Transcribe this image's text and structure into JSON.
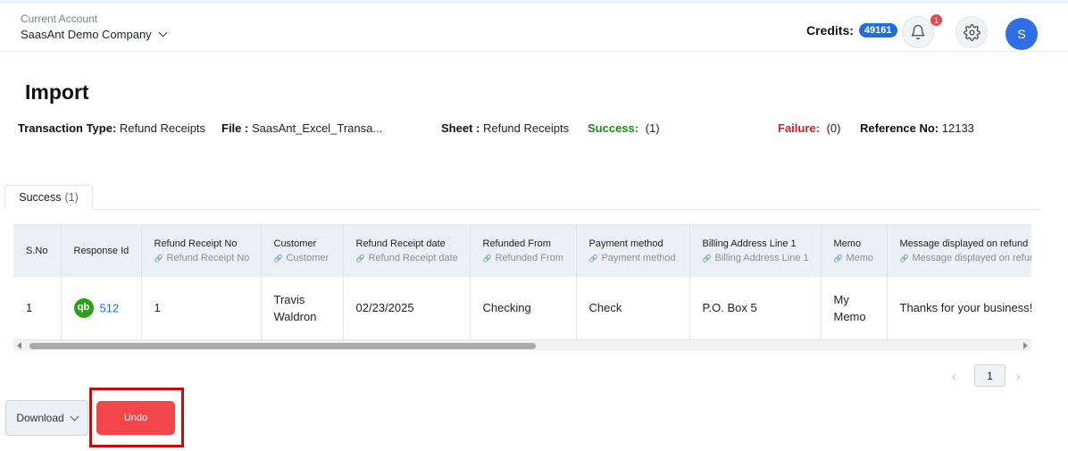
{
  "header": {
    "account_label": "Current Account",
    "account_name": "SaasAnt Demo Company",
    "credits_label": "Credits:",
    "credits_value": "49161",
    "notification_count": "1",
    "avatar_initial": "S"
  },
  "page": {
    "title": "Import",
    "transaction_type_label": "Transaction Type:",
    "transaction_type_value": "Refund Receipts",
    "file_label": "File :",
    "file_value": "SaasAnt_Excel_Transa...",
    "sheet_label": "Sheet :",
    "sheet_value": "Refund Receipts",
    "success_label": "Success:",
    "success_value": "(1)",
    "failure_label": "Failure:",
    "failure_value": "(0)",
    "reference_label": "Reference No:",
    "reference_value": "12133"
  },
  "tabs": [
    {
      "label": "Success",
      "count": "(1)"
    }
  ],
  "table": {
    "columns": [
      {
        "title": "S.No",
        "sub": ""
      },
      {
        "title": "Response Id",
        "sub": ""
      },
      {
        "title": "Refund Receipt No",
        "sub": "Refund Receipt No"
      },
      {
        "title": "Customer",
        "sub": "Customer"
      },
      {
        "title": "Refund Receipt date",
        "sub": "Refund Receipt date"
      },
      {
        "title": "Refunded From",
        "sub": "Refunded From"
      },
      {
        "title": "Payment method",
        "sub": "Payment method"
      },
      {
        "title": "Billing Address Line 1",
        "sub": "Billing Address Line 1"
      },
      {
        "title": "Memo",
        "sub": "Memo"
      },
      {
        "title": "Message displayed on refund r",
        "sub": "Message displayed on refun"
      }
    ],
    "rows": [
      {
        "sno": "1",
        "response_icon": "qb",
        "response_id": "512",
        "refund_receipt_no": "1",
        "customer_line1": "Travis",
        "customer_line2": "Waldron",
        "date": "02/23/2025",
        "refunded_from": "Checking",
        "payment_method": "Check",
        "billing_address": "P.O. Box 5",
        "memo_line1": "My",
        "memo_line2": "Memo",
        "message": "Thanks for your business!"
      }
    ]
  },
  "pagination": {
    "prev": "‹",
    "current": "1",
    "next": "›"
  },
  "actions": {
    "download_label": "Download",
    "undo_label": "Undo"
  }
}
